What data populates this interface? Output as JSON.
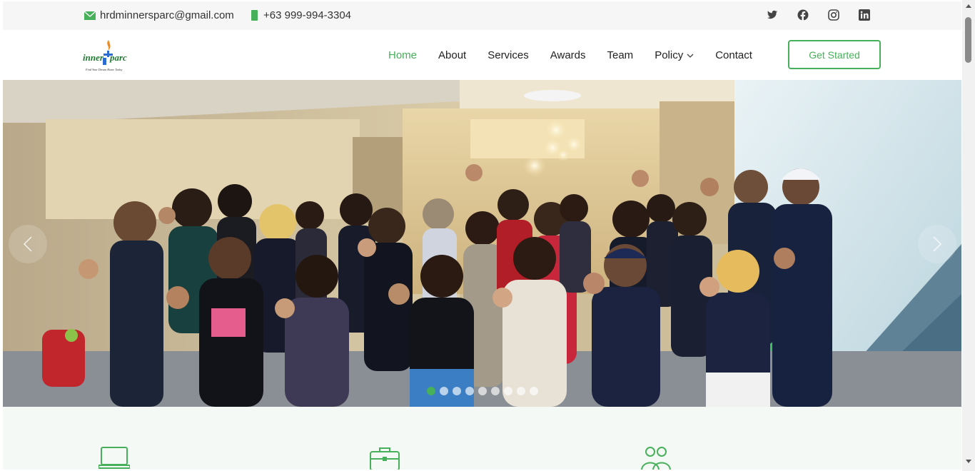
{
  "topbar": {
    "email": "hrdminnersparc@gmail.com",
    "phone": "+63 999-994-3304",
    "socials": [
      {
        "icon": "twitter-icon"
      },
      {
        "icon": "facebook-icon"
      },
      {
        "icon": "instagram-icon"
      },
      {
        "icon": "linkedin-icon"
      }
    ]
  },
  "logo": {
    "text": "inner sparc",
    "tagline": "Find Your Dream Home Today"
  },
  "nav": {
    "items": [
      {
        "label": "Home",
        "active": true
      },
      {
        "label": "About"
      },
      {
        "label": "Services"
      },
      {
        "label": "Awards"
      },
      {
        "label": "Team"
      },
      {
        "label": "Policy",
        "dropdown": true
      },
      {
        "label": "Contact"
      }
    ],
    "cta": "Get Started"
  },
  "hero": {
    "slide_count": 9,
    "active_slide": 1,
    "image": "group-photo"
  },
  "features": {
    "icons": [
      "laptop-icon",
      "briefcase-icon",
      "people-icon"
    ]
  },
  "colors": {
    "accent": "#47b05a",
    "topbar_bg": "#f6f6f6",
    "features_bg": "#f4f9f5"
  }
}
